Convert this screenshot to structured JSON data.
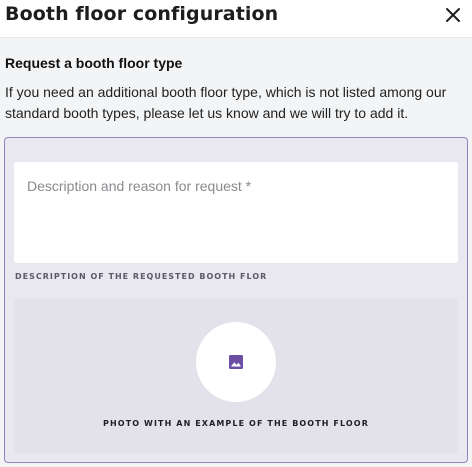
{
  "dialog": {
    "title": "Booth floor configuration",
    "close_icon": "close-icon"
  },
  "request": {
    "heading": "Request a booth floor type",
    "intro": "If you need an additional booth floor type, which is not listed among our standard booth types, please let us know and we will try to add it.",
    "description_placeholder": "Description and reason for request *",
    "description_value": "",
    "description_caption": "DESCRIPTION OF THE REQUESTED BOOTH FLOR",
    "photo_icon": "image-icon",
    "photo_caption": "PHOTO WITH AN EXAMPLE OF THE BOOTH FLOOR"
  },
  "colors": {
    "accent": "#6a4fa3",
    "card_border": "#8e85c2",
    "card_background": "#e9e7ef",
    "page_background": "#f3f4f6"
  }
}
